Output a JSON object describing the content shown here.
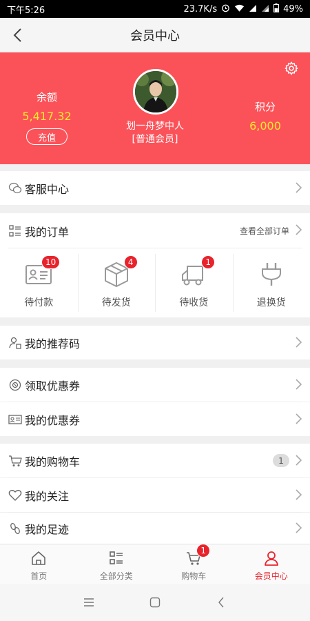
{
  "status_bar": {
    "time": "下午5:26",
    "network_speed": "23.7K/s",
    "battery": "49%",
    "icons": [
      "alarm-icon",
      "wifi-icon",
      "signal-icon",
      "signal-icon",
      "battery-icon"
    ]
  },
  "nav": {
    "title": "会员中心",
    "back_icon": "chevron-left-icon"
  },
  "header": {
    "background": "#fb525a",
    "value_color": "#ffe82a",
    "balance_label": "余额",
    "balance_value": "5,417.32",
    "recharge_label": "充值",
    "points_label": "积分",
    "points_value": "6,000",
    "user_name": "划一舟梦中人",
    "user_level": "[普通会员]",
    "settings_icon": "gear-icon"
  },
  "menu": {
    "customer_service": "客服中心",
    "my_orders": "我的订单",
    "view_all_orders": "查看全部订单",
    "referral_code": "我的推荐码",
    "get_coupons": "领取优惠券",
    "my_coupons": "我的优惠券",
    "my_cart": "我的购物车",
    "cart_count": "1",
    "my_follows": "我的关注",
    "my_footprints": "我的足迹"
  },
  "orders": [
    {
      "label": "待付款",
      "badge": "10",
      "icon": "payment-card-icon"
    },
    {
      "label": "待发货",
      "badge": "4",
      "icon": "box-icon"
    },
    {
      "label": "待收货",
      "badge": "1",
      "icon": "truck-icon"
    },
    {
      "label": "退换货",
      "badge": "",
      "icon": "plug-icon"
    }
  ],
  "tabs": [
    {
      "label": "首页",
      "icon": "home-icon"
    },
    {
      "label": "全部分类",
      "icon": "category-icon"
    },
    {
      "label": "购物车",
      "icon": "cart-icon",
      "badge": "1"
    },
    {
      "label": "会员中心",
      "icon": "user-icon",
      "active": true
    }
  ],
  "accent_color": "#e8232c"
}
